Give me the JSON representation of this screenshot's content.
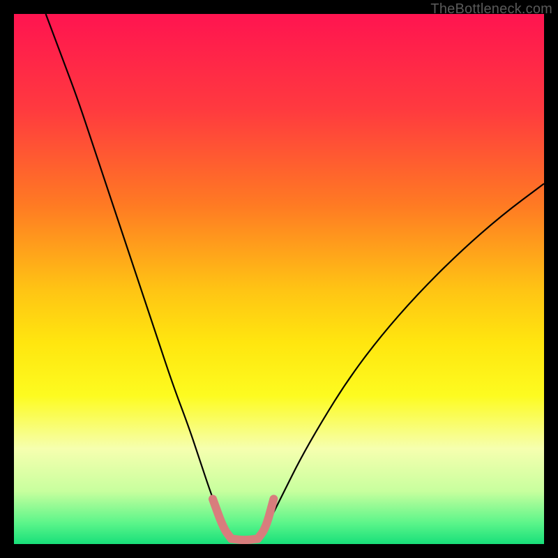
{
  "watermark": "TheBottleneck.com",
  "chart_data": {
    "type": "line",
    "title": "",
    "xlabel": "",
    "ylabel": "",
    "xlim": [
      0,
      100
    ],
    "ylim": [
      0,
      100
    ],
    "gradient_stops": [
      {
        "offset": 0.0,
        "color": "#ff1450"
      },
      {
        "offset": 0.18,
        "color": "#ff3a3f"
      },
      {
        "offset": 0.36,
        "color": "#ff7a23"
      },
      {
        "offset": 0.52,
        "color": "#ffc414"
      },
      {
        "offset": 0.62,
        "color": "#ffe60f"
      },
      {
        "offset": 0.72,
        "color": "#fdfb20"
      },
      {
        "offset": 0.82,
        "color": "#f6ffaf"
      },
      {
        "offset": 0.9,
        "color": "#c8ff9e"
      },
      {
        "offset": 0.96,
        "color": "#5cf58a"
      },
      {
        "offset": 1.0,
        "color": "#18e07a"
      }
    ],
    "series": [
      {
        "name": "left-curve",
        "stroke": "#000000",
        "stroke_width": 2.2,
        "x": [
          6,
          9,
          12,
          15,
          18,
          21,
          24,
          27,
          30,
          33,
          35,
          37,
          38.5,
          39.5
        ],
        "y": [
          100,
          92,
          84,
          75,
          66,
          57,
          48,
          39,
          30,
          22,
          16,
          10,
          6,
          3
        ]
      },
      {
        "name": "right-curve",
        "stroke": "#000000",
        "stroke_width": 2.2,
        "x": [
          47.5,
          49,
          51,
          54,
          58,
          63,
          69,
          76,
          84,
          92,
          100
        ],
        "y": [
          3,
          6,
          10,
          16,
          23,
          31,
          39,
          47,
          55,
          62,
          68
        ]
      },
      {
        "name": "left-highlight",
        "stroke": "#d87d7d",
        "stroke_width": 12,
        "linecap": "round",
        "x": [
          37.5,
          39.5,
          41.0
        ],
        "y": [
          8.5,
          3.0,
          1.0
        ]
      },
      {
        "name": "bottom-highlight",
        "stroke": "#d87d7d",
        "stroke_width": 12,
        "linecap": "round",
        "x": [
          41.0,
          43.5,
          46.0
        ],
        "y": [
          1.0,
          0.7,
          1.0
        ]
      },
      {
        "name": "right-highlight",
        "stroke": "#d87d7d",
        "stroke_width": 12,
        "linecap": "round",
        "x": [
          46.0,
          47.5,
          49.0
        ],
        "y": [
          1.0,
          3.0,
          8.5
        ]
      }
    ]
  }
}
